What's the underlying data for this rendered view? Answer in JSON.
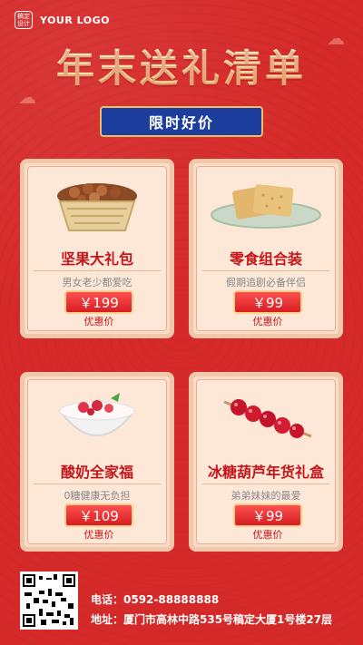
{
  "logo": {
    "badge": "稿定设计",
    "text": "YOUR LOGO"
  },
  "title": "年末送礼清单",
  "subtitle": "限时好价",
  "products": [
    {
      "name": "坚果大礼包",
      "desc": "男女老少都爱吃",
      "price": "￥199",
      "price_label": "优惠价",
      "image_icon": "nuts-basket-icon"
    },
    {
      "name": "零食组合装",
      "desc": "假期追剧必备伴侣",
      "price": "￥99",
      "price_label": "优惠价",
      "image_icon": "crackers-plate-icon"
    },
    {
      "name": "酸奶全家福",
      "desc": "0糖健康无负担",
      "price": "￥109",
      "price_label": "优惠价",
      "image_icon": "yogurt-bowl-icon"
    },
    {
      "name": "冰糖葫芦年货礼盒",
      "desc": "弟弟妹妹的最爱",
      "price": "￥99",
      "price_label": "优惠价",
      "image_icon": "candied-haws-icon"
    }
  ],
  "contact": {
    "phone": "电话：0592-88888888",
    "address": "地址：厦门市高林中路535号稿定大厦1号楼27层"
  },
  "colors": {
    "background": "#d62a2a",
    "accent": "#c4161c",
    "badge_blue": "#1e3e9e",
    "gold": "#ffd88a"
  }
}
